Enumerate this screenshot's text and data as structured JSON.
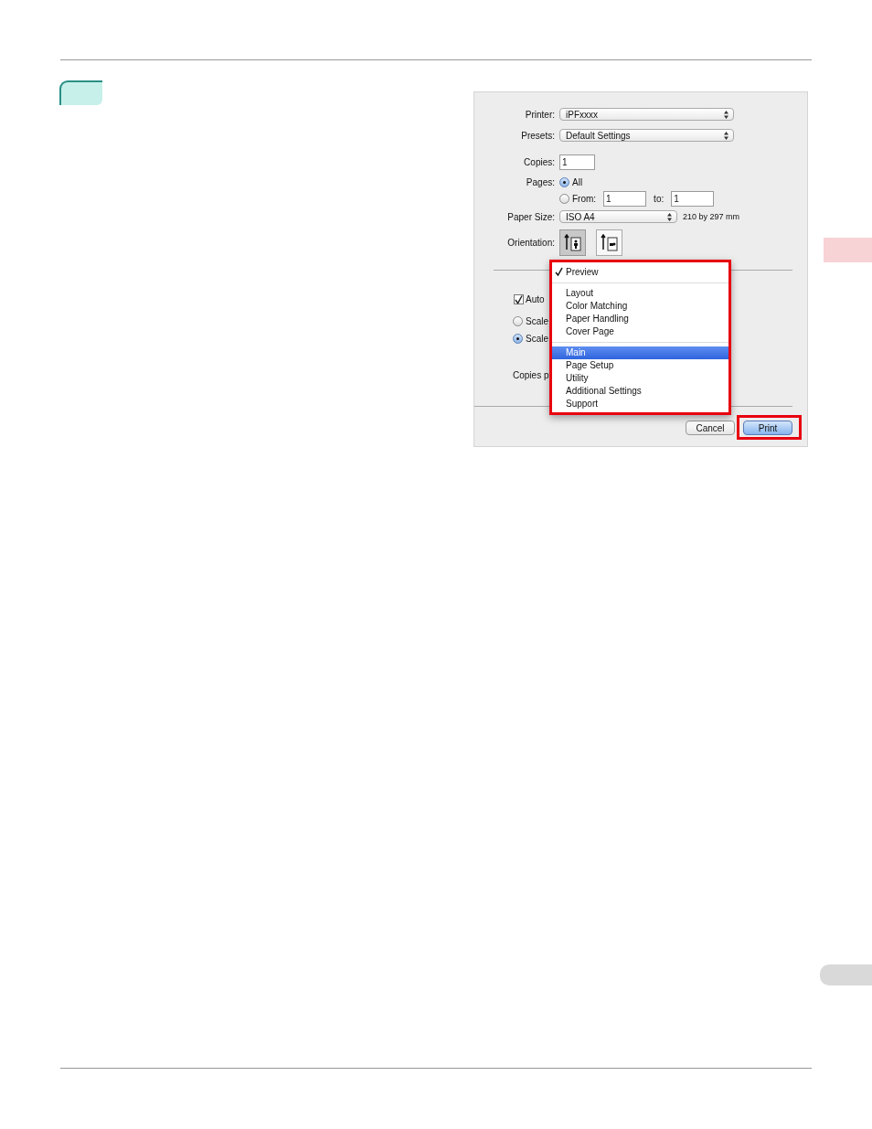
{
  "dialog": {
    "fields": [
      {
        "label": "Printer:",
        "kind": "popup",
        "value": "iPFxxxx"
      },
      {
        "label": "Presets:",
        "kind": "popup",
        "value": "Default Settings"
      },
      {
        "label": "Copies:",
        "kind": "text",
        "value": "1"
      }
    ],
    "pages": {
      "label": "Pages:",
      "options": [
        {
          "label": "All",
          "selected": true
        },
        {
          "label": "From:",
          "selected": false
        }
      ],
      "from": "1",
      "to_label": "to:",
      "to": "1"
    },
    "paper_size": {
      "label": "Paper Size:",
      "value": "ISO A4",
      "dimensions": "210 by 297 mm"
    },
    "orientation": {
      "label": "Orientation:",
      "options": [
        {
          "kind": "portrait",
          "selected": true
        },
        {
          "kind": "landscape",
          "selected": false
        }
      ]
    },
    "behind_menu": {
      "auto_checkbox": {
        "label": "Auto",
        "checked": true
      },
      "scale_options": [
        {
          "label": "Scale",
          "selected": false
        },
        {
          "label": "Scale",
          "selected": true
        }
      ],
      "copies_label": "Copies p"
    },
    "menu": {
      "annotated": true,
      "groups": [
        {
          "items": [
            {
              "label": "Preview",
              "checked": true,
              "selected": false
            }
          ]
        },
        {
          "items": [
            {
              "label": "Layout",
              "checked": false,
              "selected": false
            },
            {
              "label": "Color Matching",
              "checked": false,
              "selected": false
            },
            {
              "label": "Paper Handling",
              "checked": false,
              "selected": false
            },
            {
              "label": "Cover Page",
              "checked": false,
              "selected": false
            }
          ]
        },
        {
          "items": [
            {
              "label": "Main",
              "checked": false,
              "selected": true
            },
            {
              "label": "Page Setup",
              "checked": false,
              "selected": false
            },
            {
              "label": "Utility",
              "checked": false,
              "selected": false
            },
            {
              "label": "Additional Settings",
              "checked": false,
              "selected": false
            },
            {
              "label": "Support",
              "checked": false,
              "selected": false
            }
          ]
        }
      ]
    },
    "buttons": [
      {
        "label": "Cancel",
        "kind": "normal",
        "annotated": false
      },
      {
        "label": "Print",
        "kind": "default",
        "annotated": true
      }
    ]
  }
}
